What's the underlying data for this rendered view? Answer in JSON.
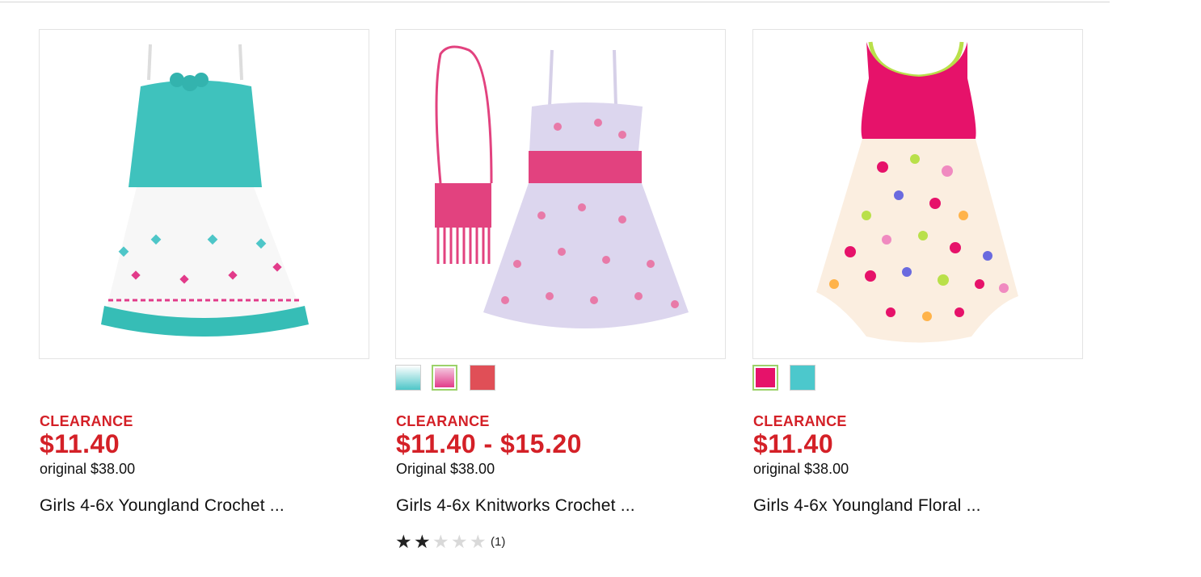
{
  "products": [
    {
      "badge": "CLEARANCE",
      "price": "$11.40",
      "original": "original $38.00",
      "title": "Girls 4-6x Youngland Crochet ...",
      "image_alt": "dress-image"
    },
    {
      "badge": "CLEARANCE",
      "price": "$11.40 - $15.20",
      "original": "Original $38.00",
      "title": "Girls 4-6x Knitworks Crochet ...",
      "swatches": [
        {
          "colors": [
            "#4ec6c8",
            "#ffffff"
          ],
          "selected": false
        },
        {
          "colors": [
            "#e23b8a",
            "#f4c6de"
          ],
          "selected": true
        },
        {
          "colors": [
            "#e04f57"
          ],
          "selected": false
        }
      ],
      "rating": 2,
      "rating_max": 5,
      "review_count": "(1)"
    },
    {
      "badge": "CLEARANCE",
      "price": "$11.40",
      "original": "original $38.00",
      "title": "Girls 4-6x Youngland Floral ...",
      "swatches": [
        {
          "colors": [
            "#e6126a"
          ],
          "selected": true
        },
        {
          "colors": [
            "#4cc8cc"
          ],
          "selected": false
        }
      ]
    }
  ],
  "colors": {
    "clearance_red": "#d42027",
    "swatch_selected_border": "#9cd26a"
  }
}
